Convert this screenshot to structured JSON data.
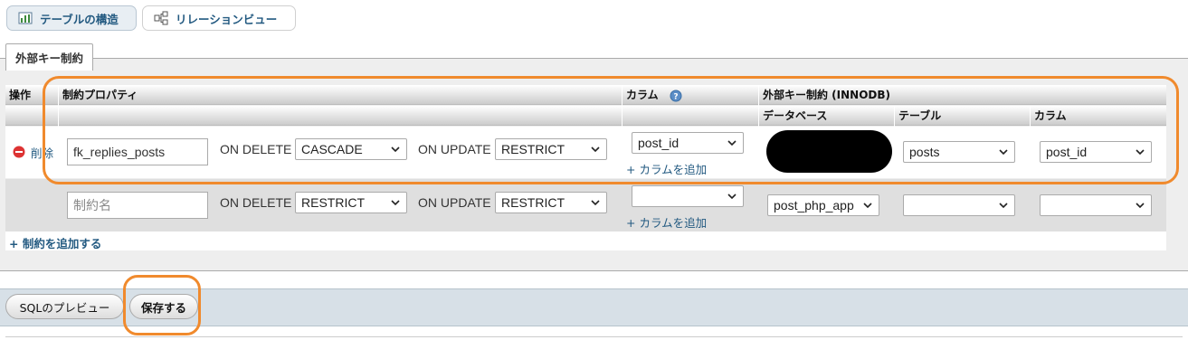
{
  "tabs": [
    {
      "label": "テーブルの構造",
      "icon": "table-structure-icon",
      "active": true
    },
    {
      "label": "リレーションビュー",
      "icon": "relation-icon",
      "active": false
    }
  ],
  "fieldset": {
    "legend": "外部キー制約"
  },
  "table": {
    "headers": {
      "actions": "操作",
      "constraint_properties": "制約プロパティ",
      "column": "カラム",
      "foreign_key": "外部キー制約 (INNODB)",
      "database": "データベース",
      "table": "テーブル",
      "fk_column": "カラム"
    },
    "rows": [
      {
        "delete_label": "削除",
        "name_value": "fk_replies_posts",
        "on_delete_label": "ON DELETE",
        "on_delete_value": "CASCADE",
        "on_update_label": "ON UPDATE",
        "on_update_value": "RESTRICT",
        "column_value": "post_id",
        "add_column": "+ カラムを追加",
        "database_value": "",
        "table_value": "posts",
        "fk_column_value": "post_id"
      },
      {
        "name_placeholder": "制約名",
        "on_delete_label": "ON DELETE",
        "on_delete_value": "RESTRICT",
        "on_update_label": "ON UPDATE",
        "on_update_value": "RESTRICT",
        "column_value": "",
        "add_column": "+ カラムを追加",
        "database_value": "post_php_app",
        "table_value": "",
        "fk_column_value": ""
      }
    ],
    "add_constraint": "+ 制約を追加する"
  },
  "buttons": {
    "preview_sql": "SQLのプレビュー",
    "save": "保存する"
  },
  "colors": {
    "highlight": "#f08a2d",
    "link": "#235a81",
    "bar": "#d7e0e7"
  }
}
